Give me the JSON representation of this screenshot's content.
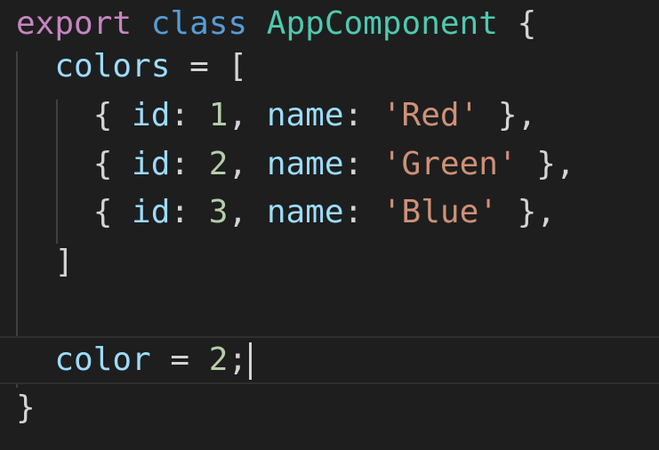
{
  "editor": {
    "lines": [
      {
        "tokens": [
          {
            "text": "export",
            "type": "kw"
          },
          {
            "text": " ",
            "type": "pun"
          },
          {
            "text": "class",
            "type": "kw2"
          },
          {
            "text": " ",
            "type": "pun"
          },
          {
            "text": "AppComponent",
            "type": "cls"
          },
          {
            "text": " {",
            "type": "pun"
          }
        ]
      },
      {
        "tokens": [
          {
            "text": "  ",
            "type": "pun"
          },
          {
            "text": "colors",
            "type": "prop"
          },
          {
            "text": " = [",
            "type": "pun"
          }
        ]
      },
      {
        "tokens": [
          {
            "text": "    { ",
            "type": "pun"
          },
          {
            "text": "id",
            "type": "prop"
          },
          {
            "text": ": ",
            "type": "pun"
          },
          {
            "text": "1",
            "type": "num"
          },
          {
            "text": ", ",
            "type": "pun"
          },
          {
            "text": "name",
            "type": "prop"
          },
          {
            "text": ": ",
            "type": "pun"
          },
          {
            "text": "'Red'",
            "type": "str"
          },
          {
            "text": " },",
            "type": "pun"
          }
        ]
      },
      {
        "tokens": [
          {
            "text": "    { ",
            "type": "pun"
          },
          {
            "text": "id",
            "type": "prop"
          },
          {
            "text": ": ",
            "type": "pun"
          },
          {
            "text": "2",
            "type": "num"
          },
          {
            "text": ", ",
            "type": "pun"
          },
          {
            "text": "name",
            "type": "prop"
          },
          {
            "text": ": ",
            "type": "pun"
          },
          {
            "text": "'Green'",
            "type": "str"
          },
          {
            "text": " },",
            "type": "pun"
          }
        ]
      },
      {
        "tokens": [
          {
            "text": "    { ",
            "type": "pun"
          },
          {
            "text": "id",
            "type": "prop"
          },
          {
            "text": ": ",
            "type": "pun"
          },
          {
            "text": "3",
            "type": "num"
          },
          {
            "text": ", ",
            "type": "pun"
          },
          {
            "text": "name",
            "type": "prop"
          },
          {
            "text": ": ",
            "type": "pun"
          },
          {
            "text": "'Blue'",
            "type": "str"
          },
          {
            "text": " },",
            "type": "pun"
          }
        ]
      },
      {
        "tokens": [
          {
            "text": "  ]",
            "type": "pun"
          }
        ]
      },
      {
        "tokens": []
      },
      {
        "active": true,
        "cursor": true,
        "tokens": [
          {
            "text": "  ",
            "type": "pun"
          },
          {
            "text": "color",
            "type": "prop"
          },
          {
            "text": " = ",
            "type": "pun"
          },
          {
            "text": "2",
            "type": "num"
          },
          {
            "text": ";",
            "type": "pun"
          }
        ]
      },
      {
        "tokens": [
          {
            "text": "}",
            "type": "pun"
          }
        ]
      }
    ]
  },
  "colors": {
    "background": "#1e1e1e",
    "keyword": "#c586c0",
    "storage": "#569cd6",
    "class_name": "#4ec9b0",
    "property": "#9cdcfe",
    "number": "#b5cea8",
    "string": "#ce9178",
    "punctuation": "#d4d4d4"
  }
}
